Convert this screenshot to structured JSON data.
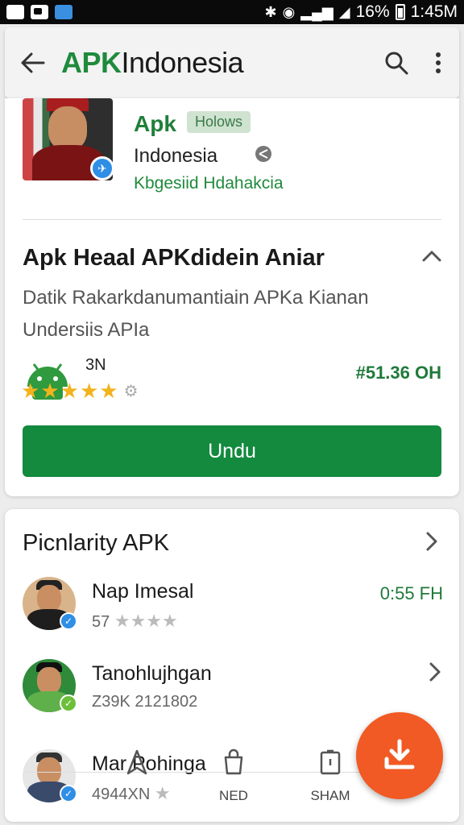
{
  "status_bar": {
    "battery": "16%",
    "time": "1:45M"
  },
  "app_bar": {
    "brand_part1": "APK",
    "brand_part2": " Indonesia"
  },
  "app": {
    "name": "Apk",
    "chip": "Holows",
    "subtitle": "Indonesia",
    "developer": "Kbgesiid Hdahakcia"
  },
  "section": {
    "title": "Apk Heaal APKdidein Aniar",
    "description": "Datik Rakarkdanumantiain APKa Kianan Undersiis APIa",
    "rating_count": "3N",
    "size": "#51.36 OH",
    "download_label": "Undu"
  },
  "list": {
    "title": "Picnlarity APK",
    "items": [
      {
        "name": "Nap Imesal",
        "meta": "57",
        "right": "0:55 FH"
      },
      {
        "name": "Tanohlujhgan",
        "meta": "Z39K 2121802",
        "right": ""
      },
      {
        "name": "Mar Pohinga",
        "meta": "4944XN",
        "right": ""
      }
    ]
  },
  "bottom_nav": {
    "items": [
      {
        "label": ""
      },
      {
        "label": "NED"
      },
      {
        "label": "SHAM"
      }
    ]
  },
  "colors": {
    "accent": "#138a3e",
    "fab": "#f15a24",
    "brand_green": "#1f8a3c"
  }
}
